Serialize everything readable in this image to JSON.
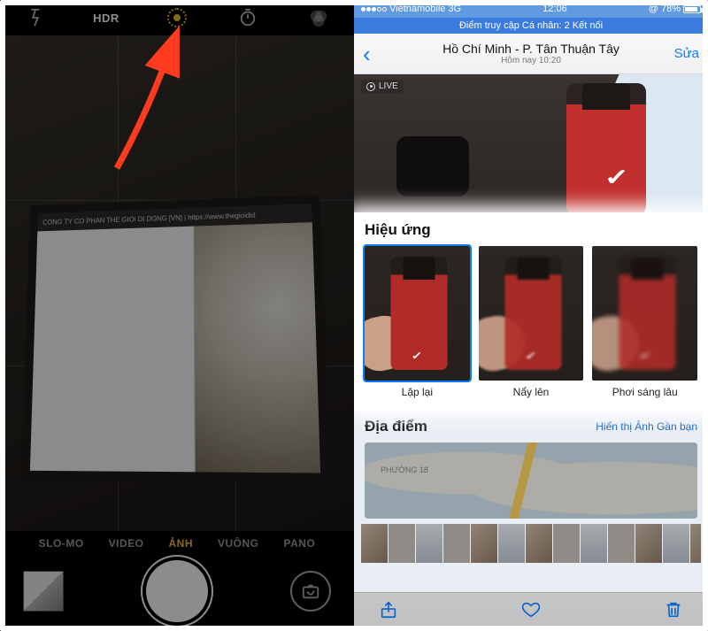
{
  "camera": {
    "hdr_label": "HDR",
    "modes": {
      "slomo": "SLO-MO",
      "video": "VIDEO",
      "photo": "ẢNH",
      "square": "VUÔNG",
      "pano": "PANO"
    },
    "browser_bar": "CONG TY CO PHAN THE GIOI DI DONG [VN] | https://www.thegioidid"
  },
  "photos": {
    "status": {
      "carrier": "Vietnamobile",
      "network": "3G",
      "time": "12:06",
      "battery": "78%"
    },
    "hotspot": "Điểm truy cập Cá nhân: 2 Kết nối",
    "nav": {
      "title": "Hồ Chí Minh - P. Tân Thuận Tây",
      "subtitle": "Hôm nay  10:20",
      "edit": "Sửa"
    },
    "live_label": "LIVE",
    "effects_title": "Hiệu ứng",
    "effects": [
      {
        "label": "Lặp lại"
      },
      {
        "label": "Nẩy lên"
      },
      {
        "label": "Phơi sáng lâu"
      }
    ],
    "places_title": "Địa điểm",
    "nearby_label": "Hiển thị Ảnh Gần bạn",
    "map_label": "PHƯỜNG 18",
    "battery_icon": "@"
  }
}
